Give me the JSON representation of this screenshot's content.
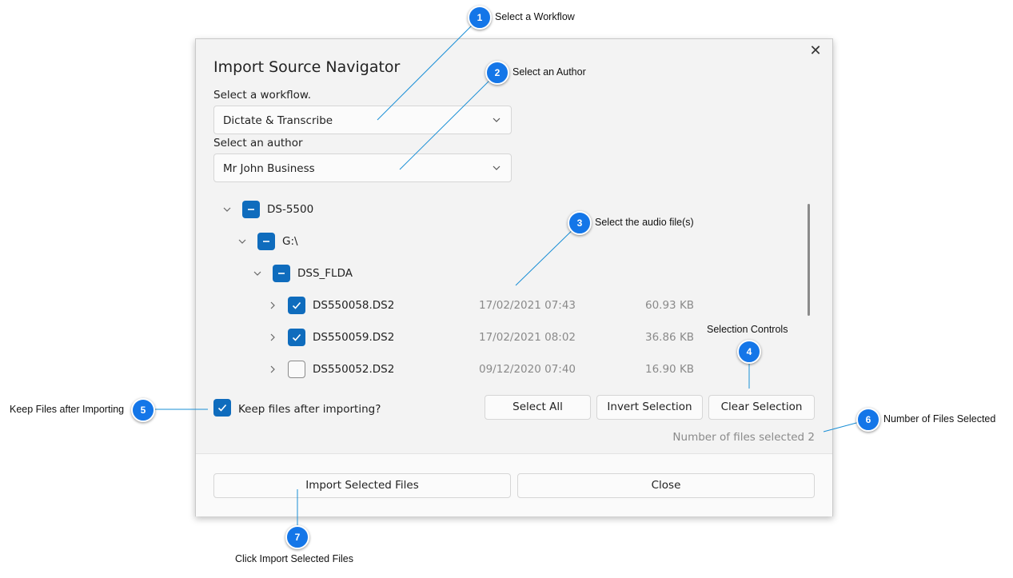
{
  "dialog": {
    "title": "Import Source Navigator",
    "close_icon": "close-icon",
    "workflow_label": "Select a workflow.",
    "workflow_value": "Dictate & Transcribe",
    "author_label": "Select an author",
    "author_value": "Mr John Business",
    "tree": {
      "device": "DS-5500",
      "drive": "G:\\",
      "folder": "DSS_FLDA",
      "files": [
        {
          "name": "DS550058.DS2",
          "date": "17/02/2021 07:43",
          "size": "60.93 KB",
          "checked": true
        },
        {
          "name": "DS550059.DS2",
          "date": "17/02/2021 08:02",
          "size": "36.86 KB",
          "checked": true
        },
        {
          "name": "DS550052.DS2",
          "date": "09/12/2020 07:40",
          "size": "16.90 KB",
          "checked": false
        }
      ]
    },
    "keep_files_label": "Keep files after importing?",
    "keep_files_checked": true,
    "buttons": {
      "select_all": "Select All",
      "invert_selection": "Invert Selection",
      "clear_selection": "Clear Selection",
      "import": "Import Selected Files",
      "close": "Close"
    },
    "files_selected_label": "Number of files selected 2"
  },
  "callouts": [
    {
      "number": "1",
      "text": "Select a Workflow"
    },
    {
      "number": "2",
      "text": "Select an Author"
    },
    {
      "number": "3",
      "text": "Select the audio file(s)"
    },
    {
      "number": "4",
      "text": "Selection Controls"
    },
    {
      "number": "5",
      "text": "Keep Files after Importing"
    },
    {
      "number": "6",
      "text": "Number of Files Selected"
    },
    {
      "number": "7",
      "text": "Click Import Selected Files"
    }
  ],
  "colors": {
    "accent": "#0f6cbd",
    "callout": "#1476e8",
    "leader_line": "#1a8fd6",
    "muted_text": "#8a8a8a"
  }
}
